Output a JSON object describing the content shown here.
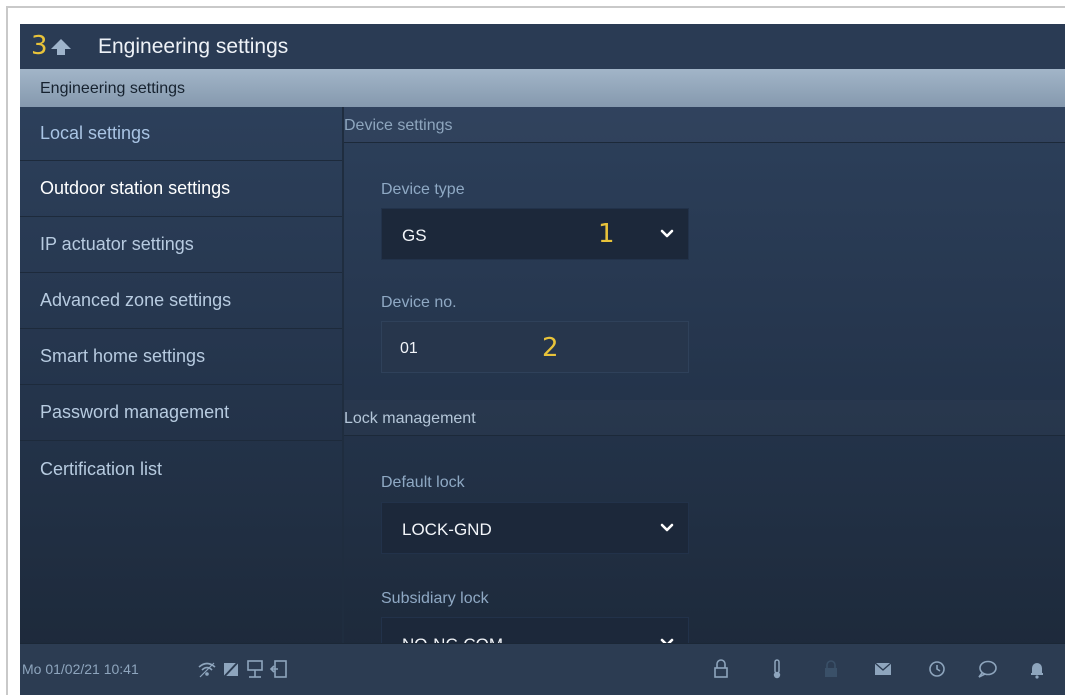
{
  "title": {
    "callout": "3",
    "text": "Engineering settings"
  },
  "band": {
    "text": "Engineering settings"
  },
  "sidebar": {
    "items": [
      {
        "label": "Local settings"
      },
      {
        "label": "Outdoor station settings"
      },
      {
        "label": "IP actuator settings"
      },
      {
        "label": "Advanced zone settings"
      },
      {
        "label": "Smart home settings"
      },
      {
        "label": "Password management"
      },
      {
        "label": "Certification list"
      }
    ],
    "active_index": 1
  },
  "device_settings": {
    "header": "Device settings",
    "device_type_label": "Device type",
    "device_type_value": "GS",
    "device_type_callout": "1",
    "device_no_label": "Device no.",
    "device_no_value": "01",
    "device_no_callout": "2"
  },
  "lock_management": {
    "header": "Lock management",
    "default_lock_label": "Default lock",
    "default_lock_value": "LOCK-GND",
    "subsidiary_lock_label": "Subsidiary lock",
    "subsidiary_lock_value": "NO-NC-COM"
  },
  "statusbar": {
    "datetime": "Mo 01/02/21  10:41",
    "left_icons": [
      "wifi-icon",
      "no-disturb-icon",
      "network-icon",
      "exit-icon"
    ],
    "right_icons": [
      "lock-icon",
      "thermometer-icon",
      "lock-locked-icon",
      "mail-icon",
      "history-icon",
      "chat-icon",
      "bell-icon"
    ]
  },
  "colors": {
    "accent_callout": "#e8c33a",
    "band": "#8fa3b8",
    "background": "#24344b"
  }
}
